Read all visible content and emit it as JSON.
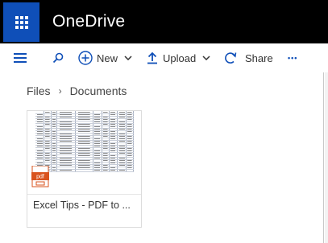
{
  "suite": {
    "app_title": "OneDrive"
  },
  "commandbar": {
    "new_label": "New",
    "upload_label": "Upload",
    "share_label": "Share",
    "more_label": "•••"
  },
  "breadcrumb": {
    "root": "Files",
    "separator": "›",
    "current": "Documents"
  },
  "files": [
    {
      "name": "Excel Tips - PDF to ...",
      "type": "pdf",
      "badge": "pdf"
    }
  ],
  "colors": {
    "suitebar": "#000000",
    "waffle": "#0f4fb8",
    "accent": "#0f4fb8",
    "pdf_red": "#d9531e"
  }
}
